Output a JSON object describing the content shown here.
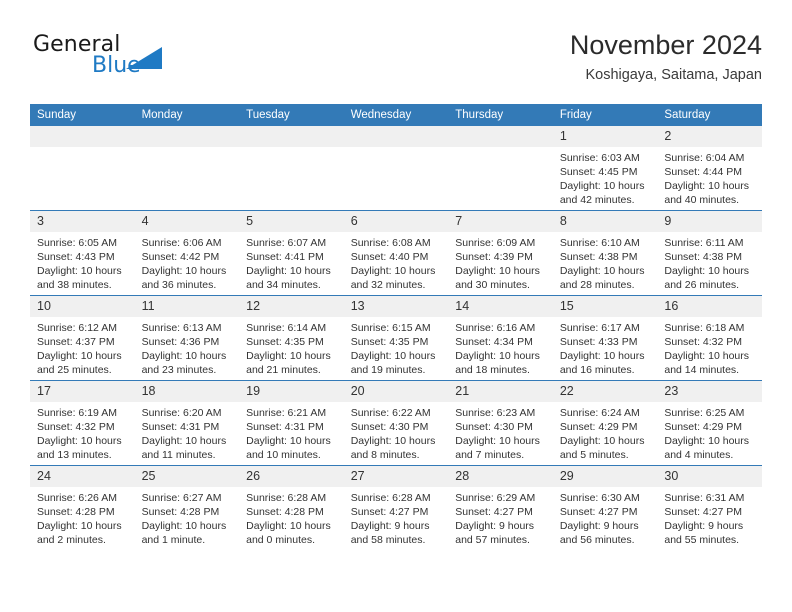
{
  "brand": {
    "name_part1": "General",
    "name_part2": "Blue",
    "triangle_color": "#1f7ac4",
    "text_color": "#1a1a1a"
  },
  "header": {
    "title": "November 2024",
    "subtitle": "Koshigaya, Saitama, Japan"
  },
  "theme": {
    "header_blue": "#337ab7",
    "daynum_band": "#f0f0f0",
    "text": "#333333"
  },
  "weekdays": [
    "Sunday",
    "Monday",
    "Tuesday",
    "Wednesday",
    "Thursday",
    "Friday",
    "Saturday"
  ],
  "weeks": [
    [
      {
        "day": "",
        "sunrise": "",
        "sunset": "",
        "daylight": "",
        "empty": true
      },
      {
        "day": "",
        "sunrise": "",
        "sunset": "",
        "daylight": "",
        "empty": true
      },
      {
        "day": "",
        "sunrise": "",
        "sunset": "",
        "daylight": "",
        "empty": true
      },
      {
        "day": "",
        "sunrise": "",
        "sunset": "",
        "daylight": "",
        "empty": true
      },
      {
        "day": "",
        "sunrise": "",
        "sunset": "",
        "daylight": "",
        "empty": true
      },
      {
        "day": "1",
        "sunrise": "Sunrise: 6:03 AM",
        "sunset": "Sunset: 4:45 PM",
        "daylight": "Daylight: 10 hours and 42 minutes.",
        "empty": false
      },
      {
        "day": "2",
        "sunrise": "Sunrise: 6:04 AM",
        "sunset": "Sunset: 4:44 PM",
        "daylight": "Daylight: 10 hours and 40 minutes.",
        "empty": false
      }
    ],
    [
      {
        "day": "3",
        "sunrise": "Sunrise: 6:05 AM",
        "sunset": "Sunset: 4:43 PM",
        "daylight": "Daylight: 10 hours and 38 minutes.",
        "empty": false
      },
      {
        "day": "4",
        "sunrise": "Sunrise: 6:06 AM",
        "sunset": "Sunset: 4:42 PM",
        "daylight": "Daylight: 10 hours and 36 minutes.",
        "empty": false
      },
      {
        "day": "5",
        "sunrise": "Sunrise: 6:07 AM",
        "sunset": "Sunset: 4:41 PM",
        "daylight": "Daylight: 10 hours and 34 minutes.",
        "empty": false
      },
      {
        "day": "6",
        "sunrise": "Sunrise: 6:08 AM",
        "sunset": "Sunset: 4:40 PM",
        "daylight": "Daylight: 10 hours and 32 minutes.",
        "empty": false
      },
      {
        "day": "7",
        "sunrise": "Sunrise: 6:09 AM",
        "sunset": "Sunset: 4:39 PM",
        "daylight": "Daylight: 10 hours and 30 minutes.",
        "empty": false
      },
      {
        "day": "8",
        "sunrise": "Sunrise: 6:10 AM",
        "sunset": "Sunset: 4:38 PM",
        "daylight": "Daylight: 10 hours and 28 minutes.",
        "empty": false
      },
      {
        "day": "9",
        "sunrise": "Sunrise: 6:11 AM",
        "sunset": "Sunset: 4:38 PM",
        "daylight": "Daylight: 10 hours and 26 minutes.",
        "empty": false
      }
    ],
    [
      {
        "day": "10",
        "sunrise": "Sunrise: 6:12 AM",
        "sunset": "Sunset: 4:37 PM",
        "daylight": "Daylight: 10 hours and 25 minutes.",
        "empty": false
      },
      {
        "day": "11",
        "sunrise": "Sunrise: 6:13 AM",
        "sunset": "Sunset: 4:36 PM",
        "daylight": "Daylight: 10 hours and 23 minutes.",
        "empty": false
      },
      {
        "day": "12",
        "sunrise": "Sunrise: 6:14 AM",
        "sunset": "Sunset: 4:35 PM",
        "daylight": "Daylight: 10 hours and 21 minutes.",
        "empty": false
      },
      {
        "day": "13",
        "sunrise": "Sunrise: 6:15 AM",
        "sunset": "Sunset: 4:35 PM",
        "daylight": "Daylight: 10 hours and 19 minutes.",
        "empty": false
      },
      {
        "day": "14",
        "sunrise": "Sunrise: 6:16 AM",
        "sunset": "Sunset: 4:34 PM",
        "daylight": "Daylight: 10 hours and 18 minutes.",
        "empty": false
      },
      {
        "day": "15",
        "sunrise": "Sunrise: 6:17 AM",
        "sunset": "Sunset: 4:33 PM",
        "daylight": "Daylight: 10 hours and 16 minutes.",
        "empty": false
      },
      {
        "day": "16",
        "sunrise": "Sunrise: 6:18 AM",
        "sunset": "Sunset: 4:32 PM",
        "daylight": "Daylight: 10 hours and 14 minutes.",
        "empty": false
      }
    ],
    [
      {
        "day": "17",
        "sunrise": "Sunrise: 6:19 AM",
        "sunset": "Sunset: 4:32 PM",
        "daylight": "Daylight: 10 hours and 13 minutes.",
        "empty": false
      },
      {
        "day": "18",
        "sunrise": "Sunrise: 6:20 AM",
        "sunset": "Sunset: 4:31 PM",
        "daylight": "Daylight: 10 hours and 11 minutes.",
        "empty": false
      },
      {
        "day": "19",
        "sunrise": "Sunrise: 6:21 AM",
        "sunset": "Sunset: 4:31 PM",
        "daylight": "Daylight: 10 hours and 10 minutes.",
        "empty": false
      },
      {
        "day": "20",
        "sunrise": "Sunrise: 6:22 AM",
        "sunset": "Sunset: 4:30 PM",
        "daylight": "Daylight: 10 hours and 8 minutes.",
        "empty": false
      },
      {
        "day": "21",
        "sunrise": "Sunrise: 6:23 AM",
        "sunset": "Sunset: 4:30 PM",
        "daylight": "Daylight: 10 hours and 7 minutes.",
        "empty": false
      },
      {
        "day": "22",
        "sunrise": "Sunrise: 6:24 AM",
        "sunset": "Sunset: 4:29 PM",
        "daylight": "Daylight: 10 hours and 5 minutes.",
        "empty": false
      },
      {
        "day": "23",
        "sunrise": "Sunrise: 6:25 AM",
        "sunset": "Sunset: 4:29 PM",
        "daylight": "Daylight: 10 hours and 4 minutes.",
        "empty": false
      }
    ],
    [
      {
        "day": "24",
        "sunrise": "Sunrise: 6:26 AM",
        "sunset": "Sunset: 4:28 PM",
        "daylight": "Daylight: 10 hours and 2 minutes.",
        "empty": false
      },
      {
        "day": "25",
        "sunrise": "Sunrise: 6:27 AM",
        "sunset": "Sunset: 4:28 PM",
        "daylight": "Daylight: 10 hours and 1 minute.",
        "empty": false
      },
      {
        "day": "26",
        "sunrise": "Sunrise: 6:28 AM",
        "sunset": "Sunset: 4:28 PM",
        "daylight": "Daylight: 10 hours and 0 minutes.",
        "empty": false
      },
      {
        "day": "27",
        "sunrise": "Sunrise: 6:28 AM",
        "sunset": "Sunset: 4:27 PM",
        "daylight": "Daylight: 9 hours and 58 minutes.",
        "empty": false
      },
      {
        "day": "28",
        "sunrise": "Sunrise: 6:29 AM",
        "sunset": "Sunset: 4:27 PM",
        "daylight": "Daylight: 9 hours and 57 minutes.",
        "empty": false
      },
      {
        "day": "29",
        "sunrise": "Sunrise: 6:30 AM",
        "sunset": "Sunset: 4:27 PM",
        "daylight": "Daylight: 9 hours and 56 minutes.",
        "empty": false
      },
      {
        "day": "30",
        "sunrise": "Sunrise: 6:31 AM",
        "sunset": "Sunset: 4:27 PM",
        "daylight": "Daylight: 9 hours and 55 minutes.",
        "empty": false
      }
    ]
  ]
}
